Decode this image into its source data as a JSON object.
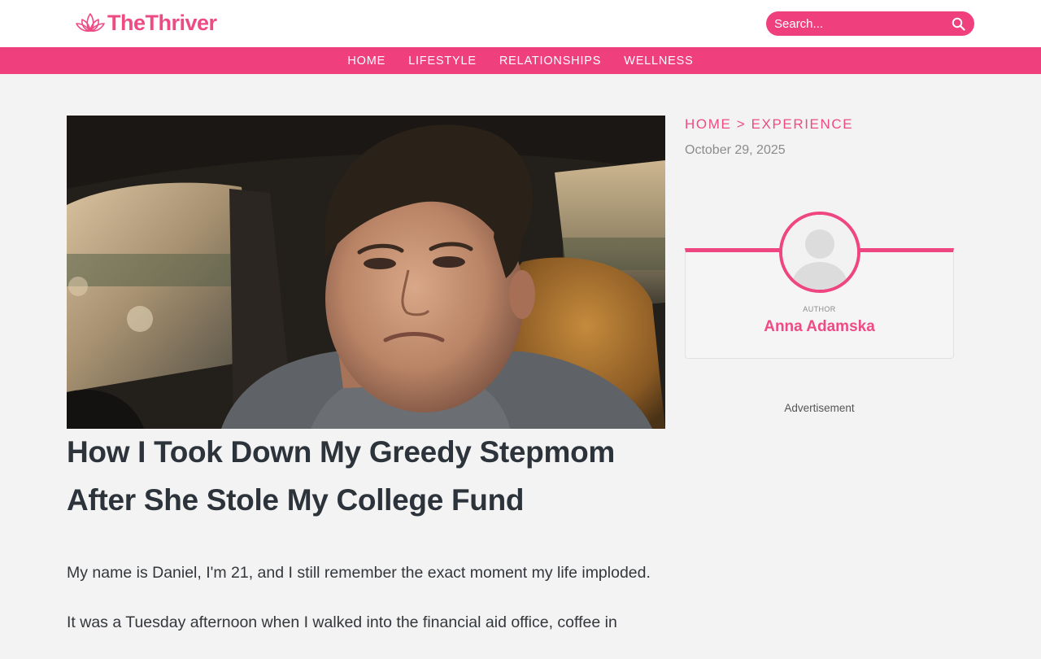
{
  "site": {
    "name": "TheThriver",
    "brand_color": "#f03f7d"
  },
  "search": {
    "placeholder": "Search..."
  },
  "nav": {
    "items": [
      {
        "label": "HOME"
      },
      {
        "label": "LIFESTYLE"
      },
      {
        "label": "RELATIONSHIPS"
      },
      {
        "label": "WELLNESS"
      }
    ]
  },
  "breadcrumb": {
    "home": "HOME",
    "separator": ">",
    "current": "EXPERIENCE"
  },
  "article": {
    "date": "October 29, 2025",
    "title": "How I Took Down My Greedy Stepmom After She Stole My College Fund",
    "paragraphs": [
      "My name is Daniel, I'm 21, and I still remember the exact moment my life imploded.",
      "It was a Tuesday afternoon when I walked into the financial aid office, coffee in"
    ]
  },
  "author": {
    "label": "AUTHOR",
    "name": "Anna Adamska"
  },
  "sidebar": {
    "ad_label": "Advertisement"
  },
  "icons": {
    "logo": "lotus-icon",
    "search": "search-icon",
    "avatar": "user-placeholder-icon"
  }
}
